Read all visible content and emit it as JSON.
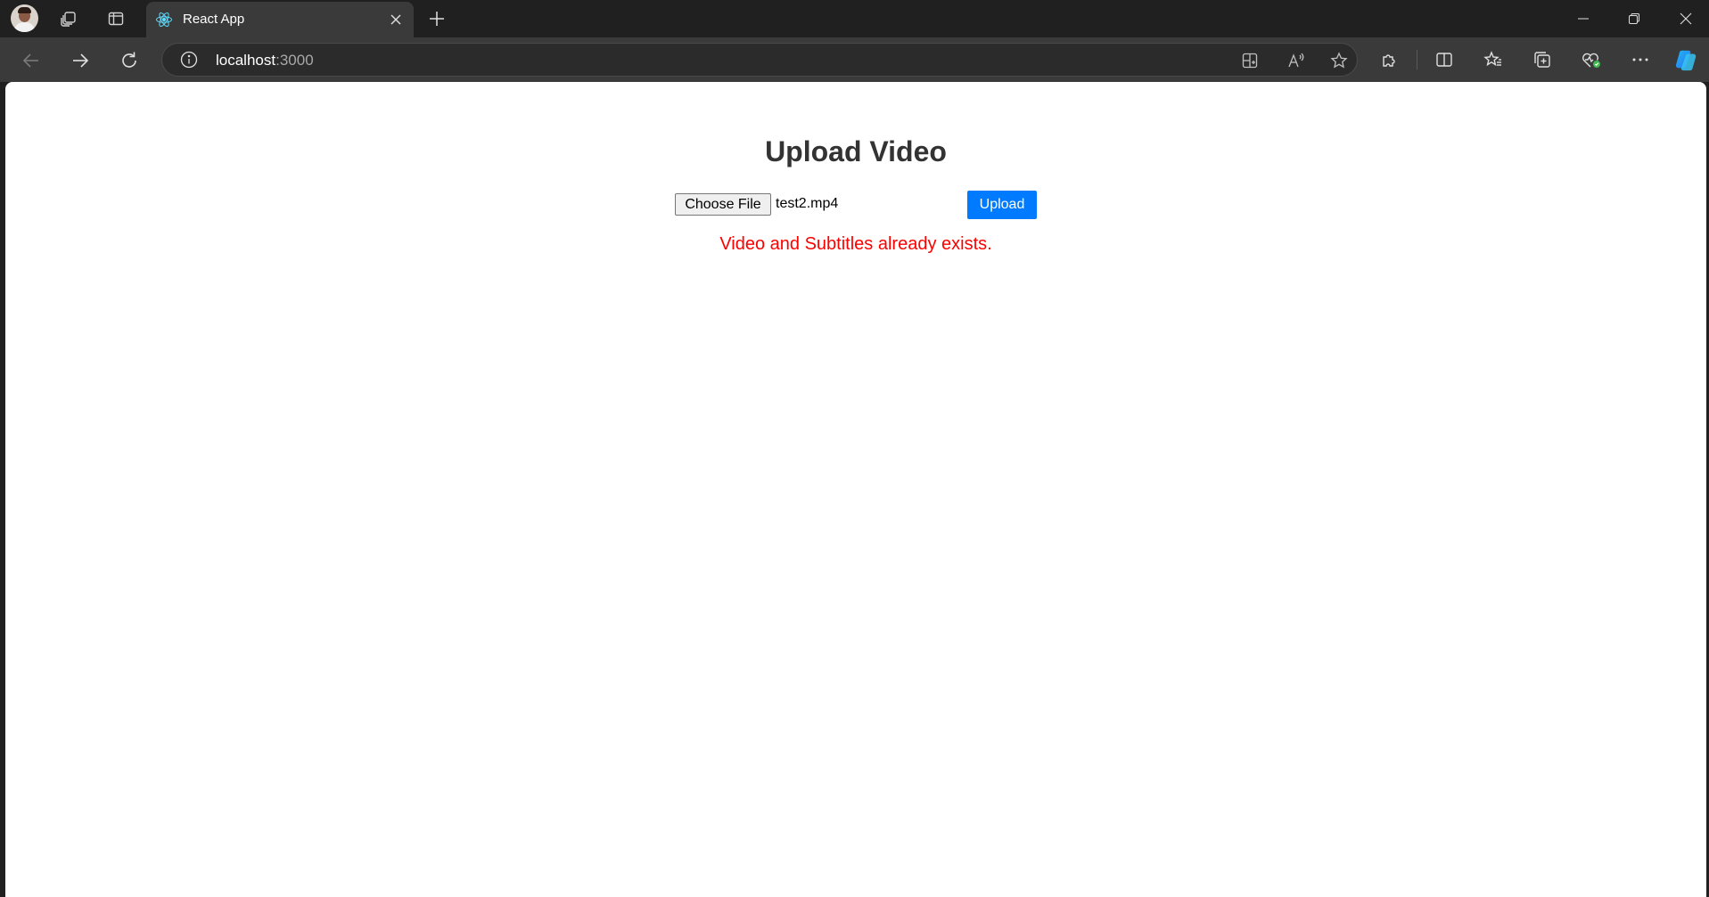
{
  "browser": {
    "tab_title": "React App",
    "url_host": "localhost",
    "url_port": ":3000"
  },
  "page": {
    "title": "Upload Video",
    "choose_file_label": "Choose File",
    "selected_file": "test2.mp4",
    "upload_label": "Upload",
    "error_message": "Video and Subtitles already exists."
  },
  "colors": {
    "upload_button": "#007bff",
    "error_text": "#ff0000",
    "title_text": "#333333"
  },
  "icons": [
    "profile-avatar",
    "workspaces-icon",
    "vertical-tabs-icon",
    "react-icon",
    "close-icon",
    "plus-icon",
    "minimize-icon",
    "restore-icon",
    "window-close-icon",
    "back-icon",
    "forward-icon",
    "refresh-icon",
    "info-icon",
    "app-available-icon",
    "read-aloud-icon",
    "favorite-star-icon",
    "extensions-icon",
    "split-screen-icon",
    "favorites-icon",
    "collections-icon",
    "browser-essentials-icon",
    "more-icon",
    "copilot-icon"
  ]
}
